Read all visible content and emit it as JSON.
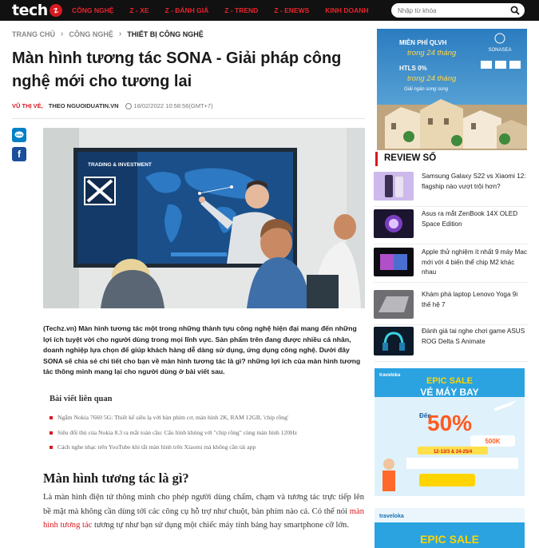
{
  "brand": {
    "logo_text": "tech",
    "logo_mark": "z"
  },
  "nav": [
    "CÔNG NGHỆ",
    "Z - XE",
    "Z - ĐÁNH GIÁ",
    "Z - TREND",
    "Z - ENEWS",
    "KINH DOANH"
  ],
  "search": {
    "placeholder": "Nhập từ khóa"
  },
  "breadcrumb": {
    "home": "TRANG CHỦ",
    "category": "CÔNG NGHỆ",
    "current": "THIẾT BỊ CÔNG NGHỆ"
  },
  "article": {
    "title": "Màn hình tương tác SONA - Giải pháp công nghệ mới cho tương lai",
    "author": "VŨ THỊ VÉ,",
    "source": "THEO NGUOIDUATIN.VN",
    "date": "18/02/2022 10:58:56(GMT+7)",
    "hero_screen_title": "TRADING & INVESTMENT",
    "lead": "(Techz.vn) Màn hình tương tác một trong những thành tựu công nghệ hiện đại mang đến những lợi ích tuyệt vời cho người dùng trong mọi lĩnh vực. Sản phẩm trên đang được nhiều cá nhân, doanh nghiệp lựa chọn để giúp khách hàng dễ dàng sử dụng, ứng dụng công nghệ. Dưới đây SONA sẽ chia sẻ chi tiết cho bạn về màn hình tương tác là gì? những lợi ích của màn hình tương tác thông minh mang lại cho người dùng ở bài viết sau.",
    "related_title": "Bài viết liên quan",
    "related": [
      "Ngắm Nokia 7660 5G: Thiết kế siêu lạ với bàn phím cơ, màn hình 2K, RAM 12GB, 'chip rồng'",
      "Siêu đối thủ của Nokia 8.3 ra mắt toàn cầu: Cấu hình khủng với \"chip rồng\" cùng màn hình 120Hz",
      "Cách nghe nhạc trên YouTube khi tắt màn hình trên Xiaomi mà không cần tải app"
    ],
    "h2": "Màn hình tương tác là gì?",
    "body_before": "Là màn hình điện tử thông minh cho phép người dùng chấm, chạm và tương tác trực tiếp lên bề mặt mà không cần dùng tới các công cụ hỗ trợ như chuột, bàn phím nào cả. Có thể nói ",
    "body_link": "màn hình tương tác",
    "body_after": " tương tự như bạn sử dụng một chiếc máy tính bảng hay smartphone cỡ lớn."
  },
  "ad_top": {
    "line1": "MIỄN PHÍ QLVH",
    "line2": "trong 24 tháng",
    "line3": "HTLS 0%",
    "line4": "trong 24 tháng",
    "line5": "Giải ngân song song",
    "brand": "SONASEA"
  },
  "sidebar": {
    "review_label": "REVIEW SỐ",
    "reviews": [
      "Samsung Galaxy S22 vs Xiaomi 12: flagship nào vượt trội hơn?",
      "Asus ra mắt ZenBook 14X OLED Space Edition",
      "Apple thử nghiệm ít nhất 9 máy Mac mới với 4 biến thể chip M2 khác nhau",
      "Khám phá laptop Lenovo Yoga 9i thế hệ 7",
      "Đánh giá tai nghe chơi game ASUS ROG Delta S Animate"
    ]
  },
  "ad_sale": {
    "brand": "traveloka",
    "epic": "EPIC SALE",
    "headline": "VÉ MÁY BAY",
    "upto": "Đến",
    "percent": "50%",
    "extra": "500K",
    "dates": "12-13/3 & 24-25/4",
    "brand2": "traveloka",
    "epic2": "EPIC SALE"
  },
  "colors": {
    "accent": "#d71920",
    "topbar": "#111111",
    "link": "#d71920"
  }
}
